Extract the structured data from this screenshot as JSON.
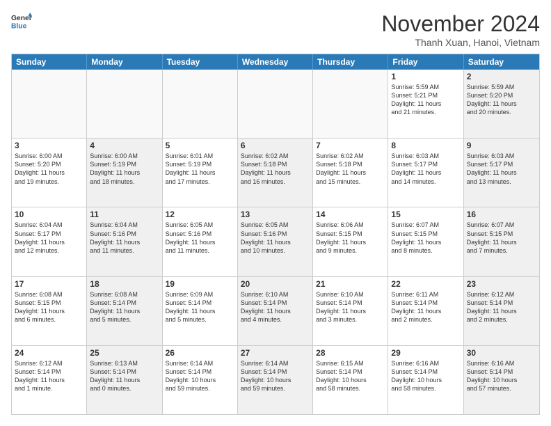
{
  "logo": {
    "line1": "General",
    "line2": "Blue"
  },
  "title": "November 2024",
  "subtitle": "Thanh Xuan, Hanoi, Vietnam",
  "header_days": [
    "Sunday",
    "Monday",
    "Tuesday",
    "Wednesday",
    "Thursday",
    "Friday",
    "Saturday"
  ],
  "weeks": [
    [
      {
        "day": "",
        "text": "",
        "empty": true
      },
      {
        "day": "",
        "text": "",
        "empty": true
      },
      {
        "day": "",
        "text": "",
        "empty": true
      },
      {
        "day": "",
        "text": "",
        "empty": true
      },
      {
        "day": "",
        "text": "",
        "empty": true
      },
      {
        "day": "1",
        "text": "Sunrise: 5:59 AM\nSunset: 5:21 PM\nDaylight: 11 hours\nand 21 minutes.",
        "empty": false
      },
      {
        "day": "2",
        "text": "Sunrise: 5:59 AM\nSunset: 5:20 PM\nDaylight: 11 hours\nand 20 minutes.",
        "empty": false,
        "shaded": true
      }
    ],
    [
      {
        "day": "3",
        "text": "Sunrise: 6:00 AM\nSunset: 5:20 PM\nDaylight: 11 hours\nand 19 minutes.",
        "empty": false
      },
      {
        "day": "4",
        "text": "Sunrise: 6:00 AM\nSunset: 5:19 PM\nDaylight: 11 hours\nand 18 minutes.",
        "empty": false,
        "shaded": true
      },
      {
        "day": "5",
        "text": "Sunrise: 6:01 AM\nSunset: 5:19 PM\nDaylight: 11 hours\nand 17 minutes.",
        "empty": false
      },
      {
        "day": "6",
        "text": "Sunrise: 6:02 AM\nSunset: 5:18 PM\nDaylight: 11 hours\nand 16 minutes.",
        "empty": false,
        "shaded": true
      },
      {
        "day": "7",
        "text": "Sunrise: 6:02 AM\nSunset: 5:18 PM\nDaylight: 11 hours\nand 15 minutes.",
        "empty": false
      },
      {
        "day": "8",
        "text": "Sunrise: 6:03 AM\nSunset: 5:17 PM\nDaylight: 11 hours\nand 14 minutes.",
        "empty": false
      },
      {
        "day": "9",
        "text": "Sunrise: 6:03 AM\nSunset: 5:17 PM\nDaylight: 11 hours\nand 13 minutes.",
        "empty": false,
        "shaded": true
      }
    ],
    [
      {
        "day": "10",
        "text": "Sunrise: 6:04 AM\nSunset: 5:17 PM\nDaylight: 11 hours\nand 12 minutes.",
        "empty": false
      },
      {
        "day": "11",
        "text": "Sunrise: 6:04 AM\nSunset: 5:16 PM\nDaylight: 11 hours\nand 11 minutes.",
        "empty": false,
        "shaded": true
      },
      {
        "day": "12",
        "text": "Sunrise: 6:05 AM\nSunset: 5:16 PM\nDaylight: 11 hours\nand 11 minutes.",
        "empty": false
      },
      {
        "day": "13",
        "text": "Sunrise: 6:05 AM\nSunset: 5:16 PM\nDaylight: 11 hours\nand 10 minutes.",
        "empty": false,
        "shaded": true
      },
      {
        "day": "14",
        "text": "Sunrise: 6:06 AM\nSunset: 5:15 PM\nDaylight: 11 hours\nand 9 minutes.",
        "empty": false
      },
      {
        "day": "15",
        "text": "Sunrise: 6:07 AM\nSunset: 5:15 PM\nDaylight: 11 hours\nand 8 minutes.",
        "empty": false
      },
      {
        "day": "16",
        "text": "Sunrise: 6:07 AM\nSunset: 5:15 PM\nDaylight: 11 hours\nand 7 minutes.",
        "empty": false,
        "shaded": true
      }
    ],
    [
      {
        "day": "17",
        "text": "Sunrise: 6:08 AM\nSunset: 5:15 PM\nDaylight: 11 hours\nand 6 minutes.",
        "empty": false
      },
      {
        "day": "18",
        "text": "Sunrise: 6:08 AM\nSunset: 5:14 PM\nDaylight: 11 hours\nand 5 minutes.",
        "empty": false,
        "shaded": true
      },
      {
        "day": "19",
        "text": "Sunrise: 6:09 AM\nSunset: 5:14 PM\nDaylight: 11 hours\nand 5 minutes.",
        "empty": false
      },
      {
        "day": "20",
        "text": "Sunrise: 6:10 AM\nSunset: 5:14 PM\nDaylight: 11 hours\nand 4 minutes.",
        "empty": false,
        "shaded": true
      },
      {
        "day": "21",
        "text": "Sunrise: 6:10 AM\nSunset: 5:14 PM\nDaylight: 11 hours\nand 3 minutes.",
        "empty": false
      },
      {
        "day": "22",
        "text": "Sunrise: 6:11 AM\nSunset: 5:14 PM\nDaylight: 11 hours\nand 2 minutes.",
        "empty": false
      },
      {
        "day": "23",
        "text": "Sunrise: 6:12 AM\nSunset: 5:14 PM\nDaylight: 11 hours\nand 2 minutes.",
        "empty": false,
        "shaded": true
      }
    ],
    [
      {
        "day": "24",
        "text": "Sunrise: 6:12 AM\nSunset: 5:14 PM\nDaylight: 11 hours\nand 1 minute.",
        "empty": false
      },
      {
        "day": "25",
        "text": "Sunrise: 6:13 AM\nSunset: 5:14 PM\nDaylight: 11 hours\nand 0 minutes.",
        "empty": false,
        "shaded": true
      },
      {
        "day": "26",
        "text": "Sunrise: 6:14 AM\nSunset: 5:14 PM\nDaylight: 10 hours\nand 59 minutes.",
        "empty": false
      },
      {
        "day": "27",
        "text": "Sunrise: 6:14 AM\nSunset: 5:14 PM\nDaylight: 10 hours\nand 59 minutes.",
        "empty": false,
        "shaded": true
      },
      {
        "day": "28",
        "text": "Sunrise: 6:15 AM\nSunset: 5:14 PM\nDaylight: 10 hours\nand 58 minutes.",
        "empty": false
      },
      {
        "day": "29",
        "text": "Sunrise: 6:16 AM\nSunset: 5:14 PM\nDaylight: 10 hours\nand 58 minutes.",
        "empty": false
      },
      {
        "day": "30",
        "text": "Sunrise: 6:16 AM\nSunset: 5:14 PM\nDaylight: 10 hours\nand 57 minutes.",
        "empty": false,
        "shaded": true
      }
    ]
  ]
}
